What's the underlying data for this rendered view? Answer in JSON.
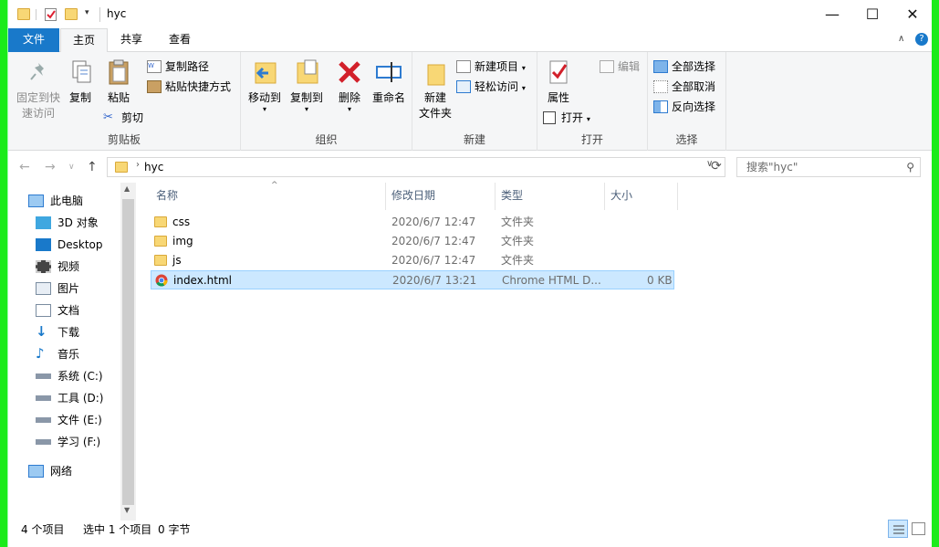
{
  "window": {
    "title": "hyc"
  },
  "caption_buttons": {
    "minimize": "—",
    "maximize": "☐",
    "close": "✕"
  },
  "tabs": [
    {
      "label": "文件"
    },
    {
      "label": "主页"
    },
    {
      "label": "共享"
    },
    {
      "label": "查看"
    }
  ],
  "ribbon": {
    "clipboard": {
      "group_label": "剪贴板",
      "pin_label_1": "固定到快",
      "pin_label_2": "速访问",
      "copy": "复制",
      "paste": "粘贴",
      "copy_path": "复制路径",
      "paste_shortcut": "粘贴快捷方式",
      "cut": "剪切"
    },
    "organize": {
      "group_label": "组织",
      "move_to": "移动到",
      "copy_to": "复制到",
      "delete": "删除",
      "rename": "重命名"
    },
    "new": {
      "group_label": "新建",
      "new_folder_1": "新建",
      "new_folder_2": "文件夹",
      "new_item": "新建项目",
      "easy_access": "轻松访问"
    },
    "open": {
      "group_label": "打开",
      "properties": "属性",
      "open": "打开",
      "edit": "编辑"
    },
    "select": {
      "group_label": "选择",
      "select_all": "全部选择",
      "select_none": "全部取消",
      "invert": "反向选择"
    }
  },
  "address": {
    "path": "hyc",
    "search_placeholder": "搜索\"hyc\""
  },
  "nav": [
    {
      "label": "此电脑"
    },
    {
      "label": "3D 对象"
    },
    {
      "label": "Desktop"
    },
    {
      "label": "视频"
    },
    {
      "label": "图片"
    },
    {
      "label": "文档"
    },
    {
      "label": "下载"
    },
    {
      "label": "音乐"
    },
    {
      "label": "系统 (C:)"
    },
    {
      "label": "工具 (D:)"
    },
    {
      "label": "文件 (E:)"
    },
    {
      "label": "学习 (F:)"
    },
    {
      "label": "网络"
    }
  ],
  "columns": {
    "name": "名称",
    "date": "修改日期",
    "type": "类型",
    "size": "大小"
  },
  "files": [
    {
      "name": "css",
      "date": "2020/6/7 12:47",
      "type": "文件夹",
      "size": ""
    },
    {
      "name": "img",
      "date": "2020/6/7 12:47",
      "type": "文件夹",
      "size": ""
    },
    {
      "name": "js",
      "date": "2020/6/7 12:47",
      "type": "文件夹",
      "size": ""
    },
    {
      "name": "index.html",
      "date": "2020/6/7 13:21",
      "type": "Chrome HTML D...",
      "size": "0 KB"
    }
  ],
  "status": {
    "items": "4 个项目",
    "selected": "选中 1 个项目",
    "bytes": "0 字节"
  },
  "colors": {
    "accent": "#1979ca",
    "selection": "#cce8ff",
    "folder": "#f8d775"
  }
}
